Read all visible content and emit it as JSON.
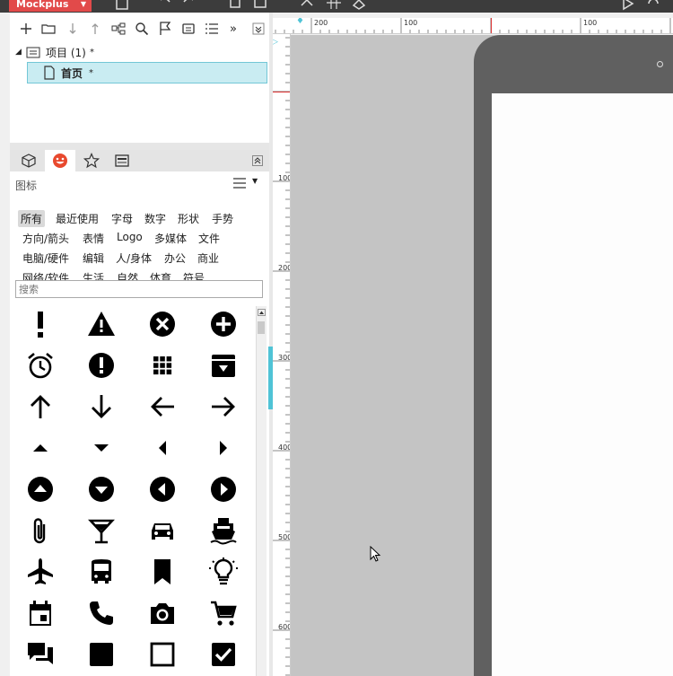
{
  "app": {
    "brand": "Mockplus",
    "brand_color": "#e24a4a"
  },
  "toolbar": {
    "icons": [
      "plus-icon",
      "folder-icon",
      "arrow-down-icon",
      "arrow-up-icon",
      "tree-icon",
      "search-icon",
      "flag-icon",
      "template-icon",
      "list-icon",
      "more-icon",
      "collapse-icon"
    ],
    "more_label": "»"
  },
  "tree": {
    "project_label": "项目 (1)",
    "project_marker": "*",
    "page_label": "首页",
    "page_marker": "*"
  },
  "tabs": [
    "component-box-icon",
    "emoji-icon",
    "star-icon",
    "template-icon"
  ],
  "icon_panel": {
    "title": "图标",
    "categories": [
      [
        "所有",
        "最近使用",
        "字母",
        "数字",
        "形状",
        "手势"
      ],
      [
        "方向/箭头",
        "表情",
        "Logo",
        "多媒体",
        "文件"
      ],
      [
        "电脑/硬件",
        "编辑",
        "人/身体",
        "办公",
        "商业"
      ],
      [
        "网络/软件",
        "生活",
        "自然",
        "体育",
        "符号"
      ]
    ],
    "active_category": "所有",
    "search_placeholder": "搜索",
    "icons": [
      "exclamation-icon",
      "warning-icon",
      "cancel-circle-icon",
      "add-circle-icon",
      "alarm-icon",
      "error-circle-icon",
      "apps-icon",
      "archive-icon",
      "arrow-up-icon",
      "arrow-down-icon",
      "arrow-left-icon",
      "arrow-right-icon",
      "caret-up-icon",
      "caret-down-icon",
      "caret-left-icon",
      "caret-right-icon",
      "circle-up-icon",
      "circle-down-icon",
      "circle-left-icon",
      "circle-right-icon",
      "attachment-icon",
      "cocktail-icon",
      "car-icon",
      "ship-icon",
      "airplane-icon",
      "bus-icon",
      "bookmark-icon",
      "lightbulb-icon",
      "calendar-icon",
      "phone-icon",
      "camera-icon",
      "cart-icon",
      "chat-icon",
      "square-filled-icon",
      "square-outline-icon",
      "checkbox-icon"
    ]
  },
  "ruler": {
    "top_labels": [
      "200",
      "100",
      "100"
    ],
    "left_labels": [
      "100",
      "200",
      "300",
      "400",
      "500",
      "600"
    ]
  },
  "colors": {
    "accent": "#4fc3d6",
    "selected_bg": "#c9ecf2",
    "canvas": "#c4c4c4",
    "device": "#606060"
  }
}
